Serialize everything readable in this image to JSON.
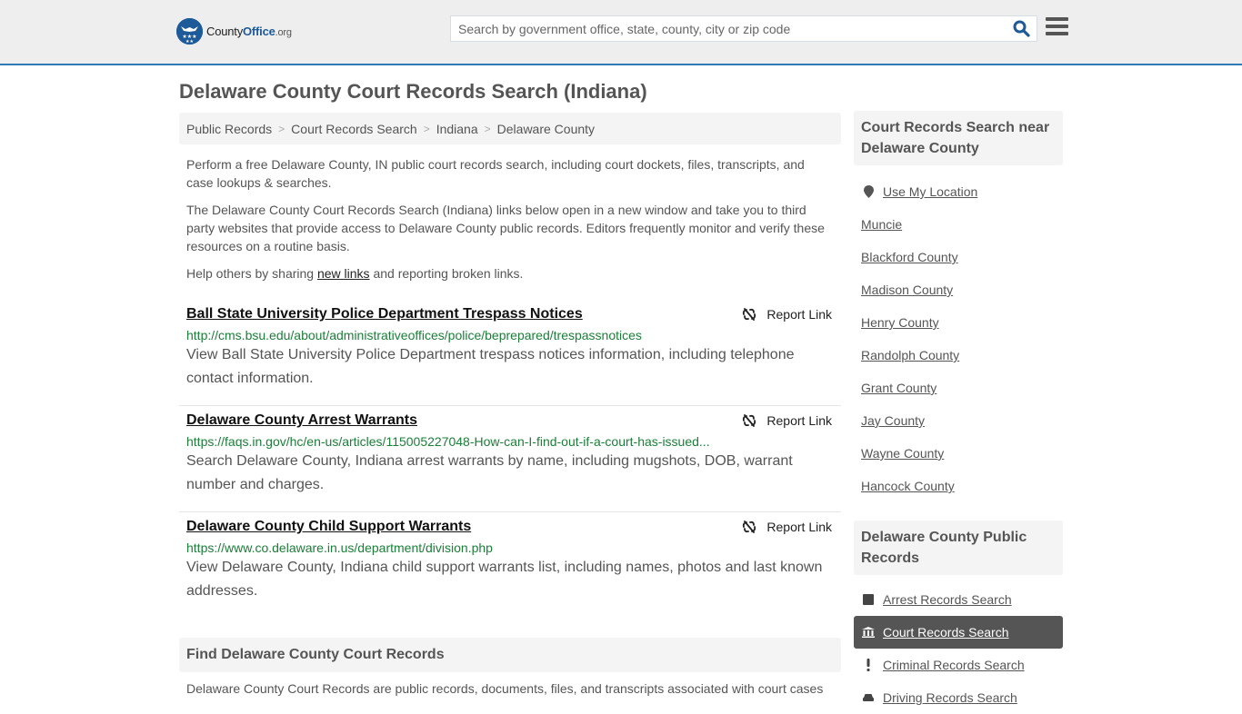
{
  "header": {
    "logo": {
      "name_part1": "County",
      "name_part2": "Office",
      "name_part3": ".org"
    },
    "search": {
      "placeholder": "Search by government office, state, county, city or zip code",
      "value": ""
    },
    "colors": {
      "brand": "#1c5a99",
      "accent_line": "#2f7ab5"
    }
  },
  "page": {
    "title": "Delaware County Court Records Search (Indiana)"
  },
  "breadcrumb": [
    {
      "label": "Public Records"
    },
    {
      "label": "Court Records Search"
    },
    {
      "label": "Indiana"
    },
    {
      "label": "Delaware County"
    }
  ],
  "intro": {
    "p1": "Perform a free Delaware County, IN public court records search, including court dockets, files, transcripts, and case lookups & searches.",
    "p2": "The Delaware County Court Records Search (Indiana) links below open in a new window and take you to third party websites that provide access to Delaware County public records. Editors frequently monitor and verify these resources on a routine basis.",
    "p3_before": "Help others by sharing ",
    "p3_link": "new links",
    "p3_after": " and reporting broken links."
  },
  "results": [
    {
      "title": "Ball State University Police Department Trespass Notices",
      "url": "http://cms.bsu.edu/about/administrativeoffices/police/beprepared/trespassnotices",
      "description": "View Ball State University Police Department trespass notices information, including telephone contact information.",
      "report_label": "Report Link"
    },
    {
      "title": "Delaware County Arrest Warrants",
      "url": "https://faqs.in.gov/hc/en-us/articles/115005227048-How-can-I-find-out-if-a-court-has-issued...",
      "description": "Search Delaware County, Indiana arrest warrants by name, including mugshots, DOB, warrant number and charges.",
      "report_label": "Report Link"
    },
    {
      "title": "Delaware County Child Support Warrants",
      "url": "https://www.co.delaware.in.us/department/division.php",
      "description": "View Delaware County, Indiana child support warrants list, including names, photos and last known addresses.",
      "report_label": "Report Link"
    }
  ],
  "find_section": {
    "heading": "Find Delaware County Court Records",
    "text": "Delaware County Court Records are public records, documents, files, and transcripts associated with court cases"
  },
  "sidebar": {
    "nearby": {
      "heading": "Court Records Search near Delaware County",
      "use_location": "Use My Location",
      "items": [
        "Muncie",
        "Blackford County",
        "Madison County",
        "Henry County",
        "Randolph County",
        "Grant County",
        "Jay County",
        "Wayne County",
        "Hancock County"
      ]
    },
    "public_records": {
      "heading": "Delaware County Public Records",
      "items": [
        {
          "label": "Arrest Records Search",
          "icon": "square-icon",
          "active": false
        },
        {
          "label": "Court Records Search",
          "icon": "courthouse-icon",
          "active": true
        },
        {
          "label": "Criminal Records Search",
          "icon": "exclamation-icon",
          "active": false
        },
        {
          "label": "Driving Records Search",
          "icon": "car-icon",
          "active": false
        }
      ]
    }
  }
}
